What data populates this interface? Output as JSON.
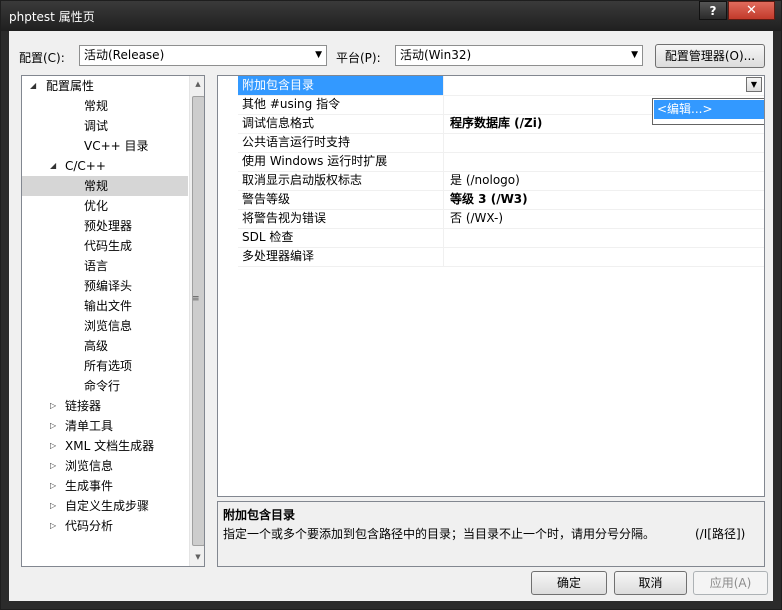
{
  "window": {
    "title": "phptest 属性页",
    "help_label": "?",
    "close_label": "✕"
  },
  "toolbar": {
    "config_label": "配置(C):",
    "config_value": "活动(Release)",
    "platform_label": "平台(P):",
    "platform_value": "活动(Win32)",
    "config_manager_label": "配置管理器(O)..."
  },
  "tree": {
    "items": [
      {
        "label": "配置属性",
        "expanded": true
      },
      {
        "label": "常规"
      },
      {
        "label": "调试"
      },
      {
        "label": "VC++ 目录"
      },
      {
        "label": "C/C++",
        "expanded": true
      },
      {
        "label": "常规",
        "selected": true
      },
      {
        "label": "优化"
      },
      {
        "label": "预处理器"
      },
      {
        "label": "代码生成"
      },
      {
        "label": "语言"
      },
      {
        "label": "预编译头"
      },
      {
        "label": "输出文件"
      },
      {
        "label": "浏览信息"
      },
      {
        "label": "高级"
      },
      {
        "label": "所有选项"
      },
      {
        "label": "命令行"
      },
      {
        "label": "链接器",
        "expanded": false
      },
      {
        "label": "清单工具",
        "expanded": false
      },
      {
        "label": "XML 文档生成器",
        "expanded": false
      },
      {
        "label": "浏览信息",
        "expanded": false
      },
      {
        "label": "生成事件",
        "expanded": false
      },
      {
        "label": "自定义生成步骤",
        "expanded": false
      },
      {
        "label": "代码分析",
        "expanded": false
      }
    ]
  },
  "grid": {
    "rows": [
      {
        "name": "附加包含目录",
        "value": "",
        "selected": true
      },
      {
        "name": "其他 #using 指令",
        "value": ""
      },
      {
        "name": "调试信息格式",
        "value": "程序数据库 (/Zi)",
        "bold": true
      },
      {
        "name": "公共语言运行时支持",
        "value": ""
      },
      {
        "name": "使用 Windows 运行时扩展",
        "value": ""
      },
      {
        "name": "取消显示启动版权标志",
        "value": "是 (/nologo)"
      },
      {
        "name": "警告等级",
        "value": "等级 3 (/W3)",
        "bold": true
      },
      {
        "name": "将警告视为错误",
        "value": "否 (/WX-)"
      },
      {
        "name": "SDL 检查",
        "value": ""
      },
      {
        "name": "多处理器编译",
        "value": ""
      }
    ],
    "dropdown_option": "<编辑...>"
  },
  "description": {
    "title": "附加包含目录",
    "text": "指定一个或多个要添加到包含路径中的目录；当目录不止一个时，请用分号分隔。",
    "switch": "(/I[路径])"
  },
  "buttons": {
    "ok": "确定",
    "cancel": "取消",
    "apply": "应用(A)"
  },
  "colors": {
    "selection": "#3399ff",
    "tree_selection": "#d6d6d6"
  }
}
